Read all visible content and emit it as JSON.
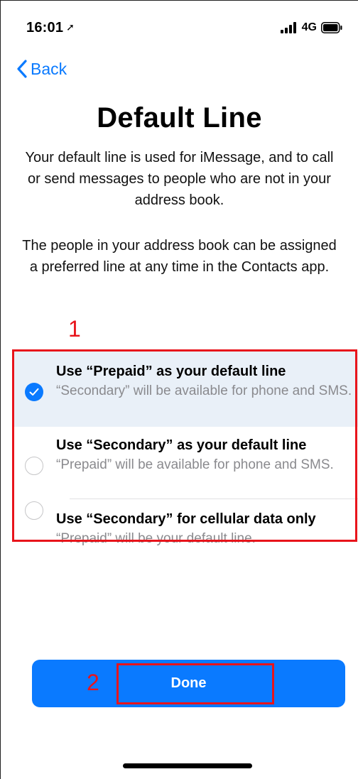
{
  "status_bar": {
    "time": "16:01",
    "location_icon": "location-arrow-icon",
    "network": "4G",
    "signal_icon": "signal-bars-icon",
    "battery_icon": "battery-icon"
  },
  "nav": {
    "back_label": "Back"
  },
  "page": {
    "title": "Default Line",
    "description_1": "Your default line is used for iMessage, and to call or send messages to people who are not in your address book.",
    "description_2": "The people in your address book can be assigned a preferred line at any time in the Contacts app."
  },
  "options": [
    {
      "title": "Use “Prepaid” as your default line",
      "subtitle": "“Secondary” will be available for phone and SMS.",
      "selected": true
    },
    {
      "title": "Use “Secondary” as your default line",
      "subtitle": "“Prepaid” will be available for phone and SMS.",
      "selected": false
    },
    {
      "title": "Use “Secondary” for cellular data only",
      "subtitle": "“Prepaid” will be your default line.",
      "selected": false
    }
  ],
  "annotations": {
    "marker_1": "1",
    "marker_2": "2",
    "color": "#e8141b"
  },
  "done_label": "Done",
  "colors": {
    "accent": "#0a7aff",
    "selected_row_bg": "#e9f0f8",
    "secondary_text": "#8a8a8e"
  }
}
